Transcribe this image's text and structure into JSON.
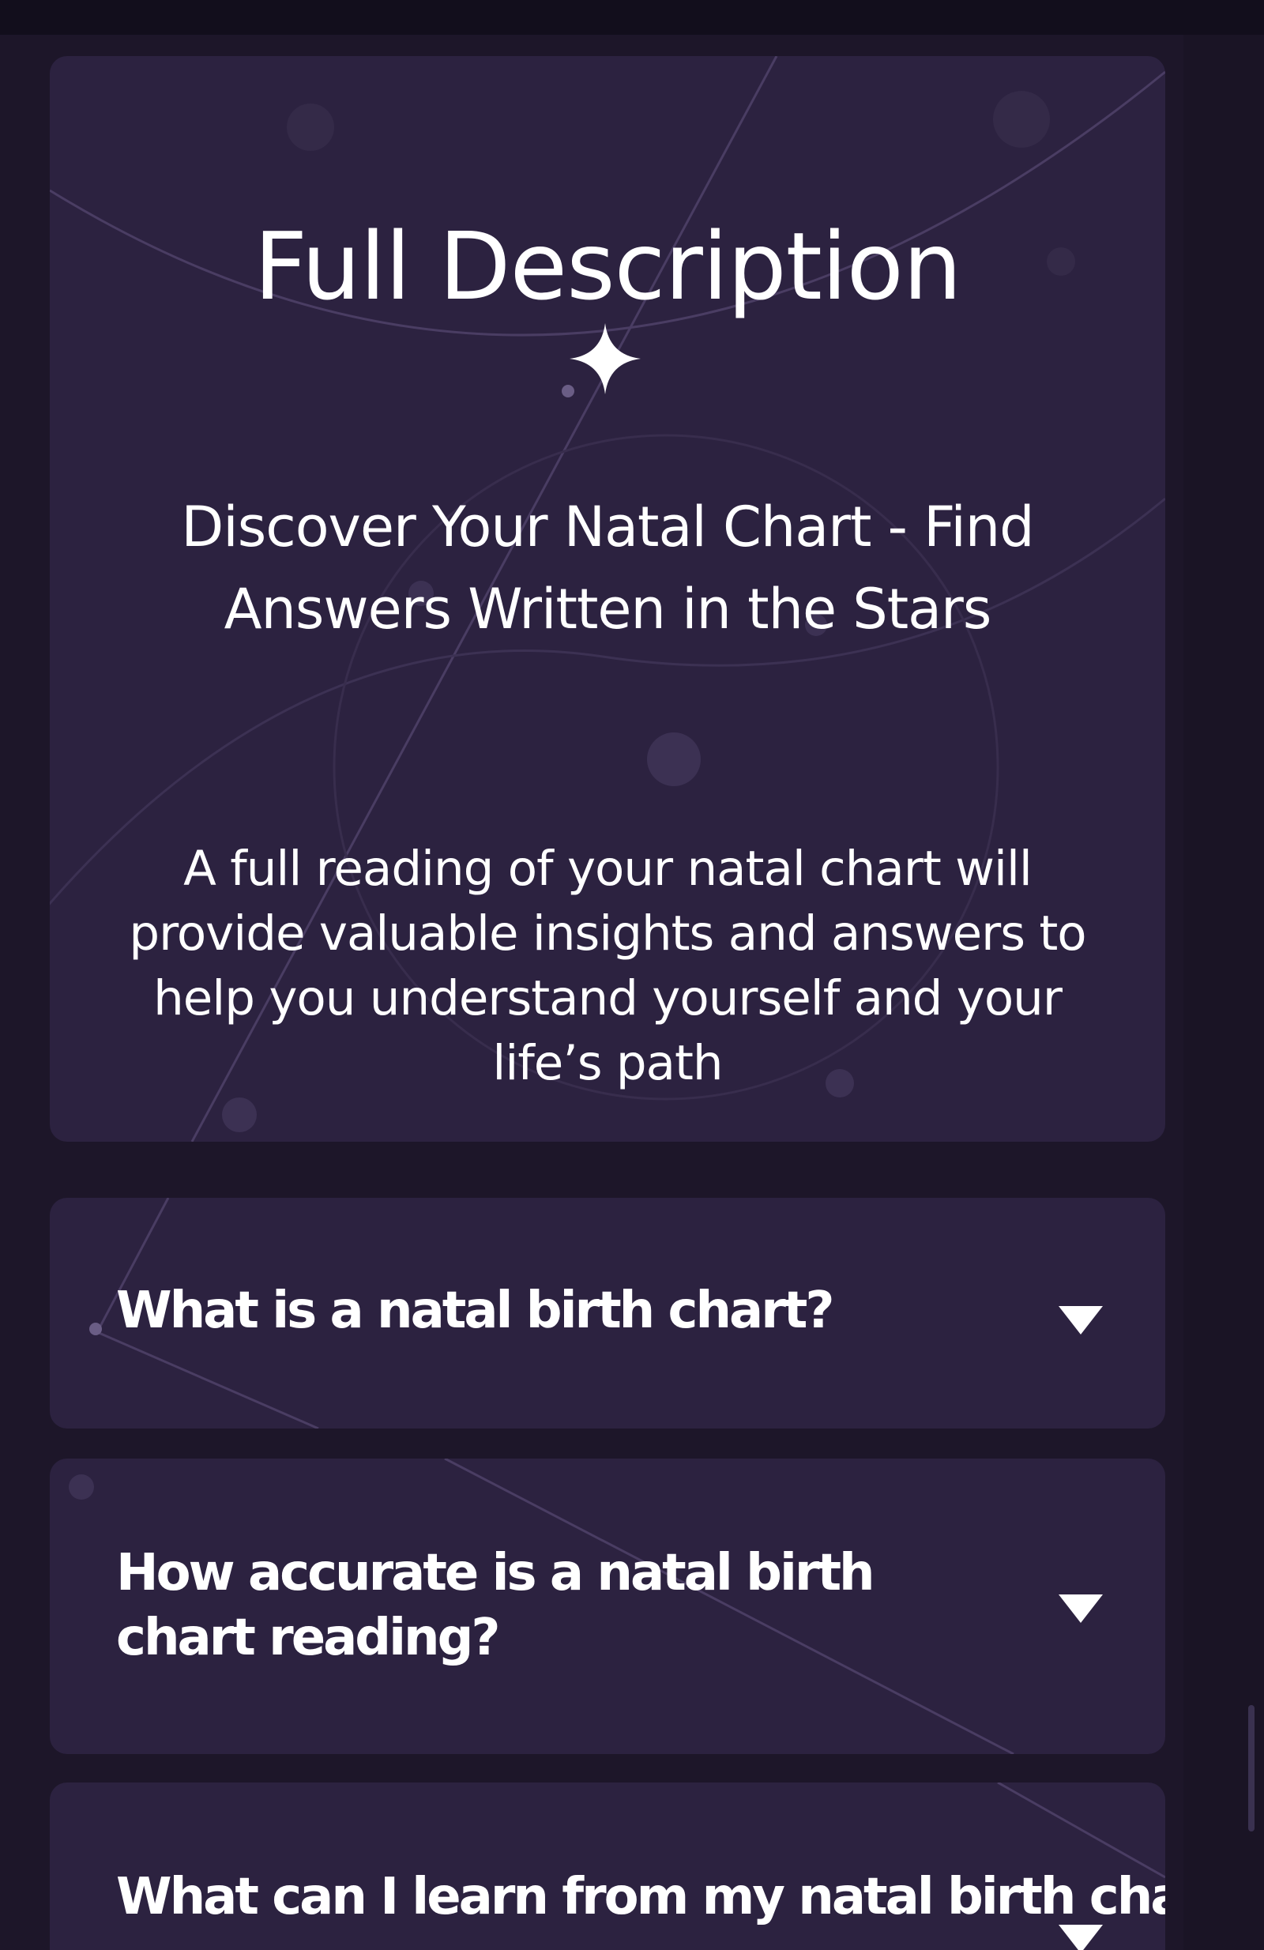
{
  "hero": {
    "title": "Full Description",
    "subtitle": "Discover Your Natal Chart - Find Answers Written in the Stars",
    "body": "A full reading of your natal chart will provide valuable insights and answers to help you understand yourself and your life’s path",
    "sparkle_icon": "four-point-star-icon"
  },
  "faq": [
    {
      "question": "What is a natal birth chart?",
      "expanded": false,
      "icon": "caret-down-icon"
    },
    {
      "question": "How accurate is a natal birth chart reading?",
      "expanded": false,
      "icon": "caret-down-icon"
    },
    {
      "question": "What can I learn from my natal birth chart?",
      "expanded": false,
      "icon": "caret-down-icon"
    }
  ],
  "colors": {
    "page_background": "#1d1629",
    "card_background": "#2c2240",
    "top_bar": "#120e1c",
    "text": "#ffffff"
  }
}
